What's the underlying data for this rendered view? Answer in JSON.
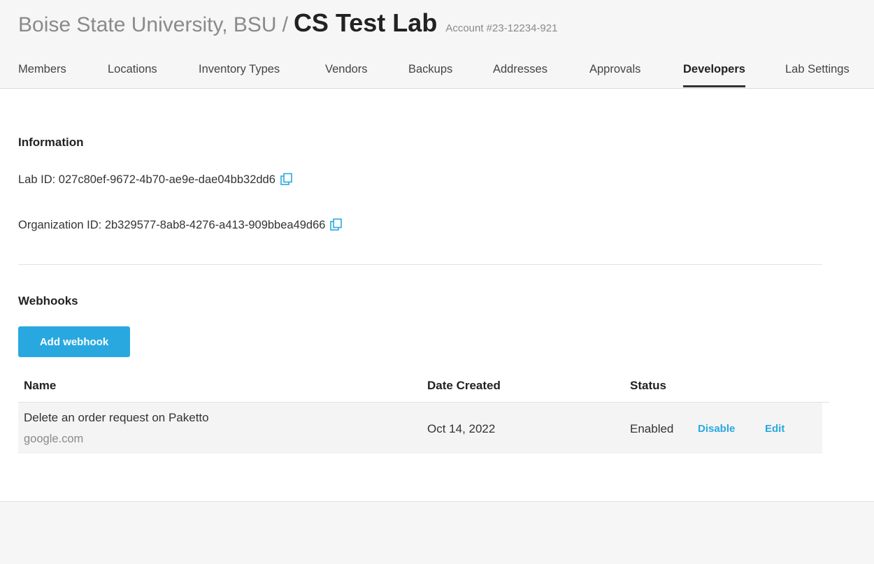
{
  "header": {
    "org_name": "Boise State University, BSU",
    "separator": "/",
    "lab_name": "CS Test Lab",
    "account": "Account #23-12234-921"
  },
  "tabs": [
    {
      "label": "Members",
      "active": false
    },
    {
      "label": "Locations",
      "active": false
    },
    {
      "label": "Inventory Types",
      "active": false
    },
    {
      "label": "Vendors",
      "active": false
    },
    {
      "label": "Backups",
      "active": false
    },
    {
      "label": "Addresses",
      "active": false
    },
    {
      "label": "Approvals",
      "active": false
    },
    {
      "label": "Developers",
      "active": true
    },
    {
      "label": "Lab Settings",
      "active": false
    }
  ],
  "information": {
    "title": "Information",
    "lab_id_label": "Lab ID:",
    "lab_id": "027c80ef-9672-4b70-ae9e-dae04bb32dd6",
    "org_id_label": "Organization ID:",
    "org_id": "2b329577-8ab8-4276-a413-909bbea49d66"
  },
  "webhooks": {
    "title": "Webhooks",
    "add_button": "Add webhook",
    "columns": {
      "name": "Name",
      "date_created": "Date Created",
      "status": "Status"
    },
    "rows": [
      {
        "name": "Delete an order request on Paketto",
        "url": "google.com",
        "date_created": "Oct 14, 2022",
        "status": "Enabled",
        "disable_label": "Disable",
        "edit_label": "Edit"
      }
    ]
  },
  "colors": {
    "accent": "#29a8e0",
    "header_bg": "#f6f6f6",
    "row_bg": "#f4f4f4"
  },
  "icons": {
    "copy": "copy-icon"
  }
}
